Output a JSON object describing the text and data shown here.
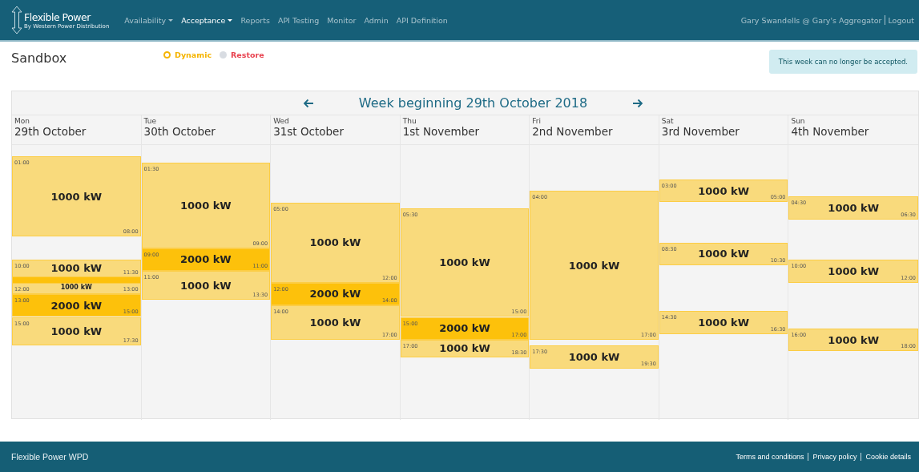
{
  "navbar": {
    "logo": {
      "title": "Flexible Power",
      "subtitle": "By Western Power Distribution"
    },
    "items": [
      {
        "label": "Availability",
        "dropdown": true,
        "selected": false
      },
      {
        "label": "Acceptance",
        "dropdown": true,
        "selected": true
      },
      {
        "label": "Reports",
        "dropdown": false,
        "selected": false
      },
      {
        "label": "API Testing",
        "dropdown": false,
        "selected": false
      },
      {
        "label": "Monitor",
        "dropdown": false,
        "selected": false
      },
      {
        "label": "Admin",
        "dropdown": false,
        "selected": false
      },
      {
        "label": "API Definition",
        "dropdown": false,
        "selected": false
      }
    ],
    "user": "Gary Swandells @ Gary's Aggregator",
    "logout": "Logout"
  },
  "page_title": "Sandbox",
  "legend": [
    {
      "label": "Dynamic",
      "selected": true,
      "color": "#f5b400"
    },
    {
      "label": "Restore",
      "selected": false,
      "color": "#e8424f"
    }
  ],
  "alert": "This week can no longer be accepted.",
  "calendar": {
    "title": "Week beginning 29th October 2018",
    "days": [
      {
        "weekday": "Mon",
        "date": "29th October",
        "blocks": [
          {
            "kind": "normal",
            "start": "01:00",
            "end": "08:00",
            "power": "1000 kW"
          },
          {
            "kind": "normal",
            "start": "10:00",
            "end": "11:30",
            "power": "1000 kW"
          },
          {
            "kind": "filler"
          },
          {
            "kind": "normal",
            "start": "12:00",
            "end": "13:00",
            "power": "1000 kW"
          },
          {
            "kind": "high",
            "start": "13:00",
            "end": "15:00",
            "power": "2000 kW"
          },
          {
            "kind": "normal",
            "start": "15:00",
            "end": "17:30",
            "power": "1000 kW"
          }
        ]
      },
      {
        "weekday": "Tue",
        "date": "30th October",
        "blocks": [
          {
            "kind": "normal",
            "start": "01:30",
            "end": "09:00",
            "power": "1000 kW"
          },
          {
            "kind": "high",
            "start": "09:00",
            "end": "11:00",
            "power": "2000 kW"
          },
          {
            "kind": "normal",
            "start": "11:00",
            "end": "13:30",
            "power": "1000 kW"
          }
        ]
      },
      {
        "weekday": "Wed",
        "date": "31st October",
        "blocks": [
          {
            "kind": "normal",
            "start": "05:00",
            "end": "12:00",
            "power": "1000 kW"
          },
          {
            "kind": "high",
            "start": "12:00",
            "end": "14:00",
            "power": "2000 kW"
          },
          {
            "kind": "normal",
            "start": "14:00",
            "end": "17:00",
            "power": "1000 kW"
          }
        ]
      },
      {
        "weekday": "Thu",
        "date": "1st November",
        "blocks": [
          {
            "kind": "normal",
            "start": "05:30",
            "end": "15:00",
            "power": "1000 kW"
          },
          {
            "kind": "high",
            "start": "15:00",
            "end": "17:00",
            "power": "2000 kW"
          },
          {
            "kind": "normal",
            "start": "17:00",
            "end": "18:30",
            "power": "1000 kW"
          }
        ]
      },
      {
        "weekday": "Fri",
        "date": "2nd November",
        "blocks": [
          {
            "kind": "normal",
            "start": "04:00",
            "end": "17:00",
            "power": "1000 kW"
          },
          {
            "kind": "normal",
            "start": "17:30",
            "end": "19:30",
            "power": "1000 kW"
          }
        ]
      },
      {
        "weekday": "Sat",
        "date": "3rd November",
        "blocks": [
          {
            "kind": "normal",
            "start": "03:00",
            "end": "05:00",
            "power": "1000 kW"
          },
          {
            "kind": "normal",
            "start": "08:30",
            "end": "10:30",
            "power": "1000 kW"
          },
          {
            "kind": "normal",
            "start": "14:30",
            "end": "16:30",
            "power": "1000 kW"
          }
        ]
      },
      {
        "weekday": "Sun",
        "date": "4th November",
        "blocks": [
          {
            "kind": "normal",
            "start": "04:30",
            "end": "06:30",
            "power": "1000 kW"
          },
          {
            "kind": "normal",
            "start": "10:00",
            "end": "12:00",
            "power": "1000 kW"
          },
          {
            "kind": "normal",
            "start": "16:00",
            "end": "18:00",
            "power": "1000 kW"
          }
        ]
      }
    ]
  },
  "footer": {
    "brand": "Flexible Power WPD",
    "links": [
      "Terms and conditions",
      "Privacy policy",
      "Cookie details"
    ]
  }
}
